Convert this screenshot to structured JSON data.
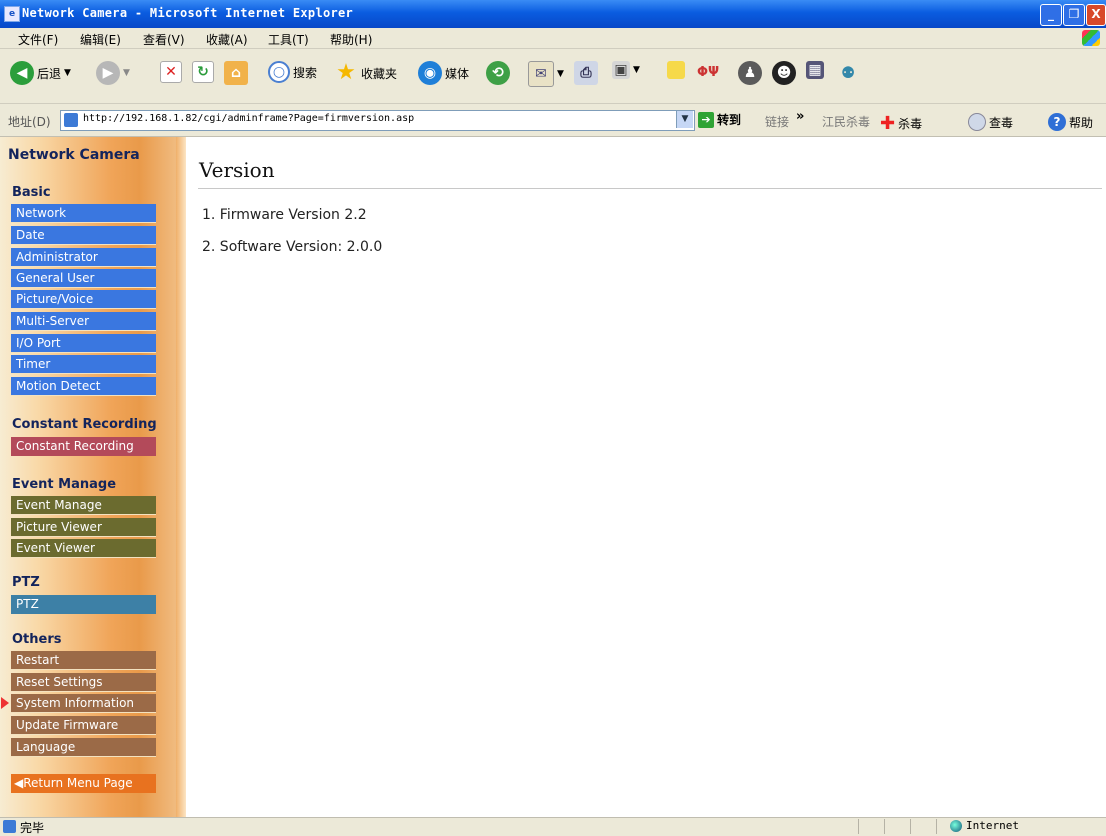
{
  "window": {
    "title": "Network Camera - Microsoft Internet Explorer",
    "min": "_",
    "max": "❐",
    "close": "X"
  },
  "menu": [
    "文件(F)",
    "编辑(E)",
    "查看(V)",
    "收藏(A)",
    "工具(T)",
    "帮助(H)"
  ],
  "toolbar": {
    "back": "后退",
    "search": "搜索",
    "favorites": "收藏夹",
    "media": "媒体"
  },
  "address": {
    "label": "地址(D)",
    "url": "http://192.168.1.82/cgi/adminframe?Page=firmversion.asp",
    "go": "转到",
    "links": "链接",
    "jiangmin": "江民杀毒",
    "kill": "杀毒",
    "scan": "查毒",
    "help": "帮助"
  },
  "sidebar": {
    "title": "Network Camera",
    "sections": {
      "basic": "Basic",
      "constant": "Constant Recording",
      "event": "Event Manage",
      "ptz": "PTZ",
      "others": "Others"
    },
    "basic_items": [
      "Network",
      "Date",
      "Administrator",
      "General User",
      "Picture/Voice",
      "Multi-Server",
      "I/O Port",
      "Timer",
      "Motion Detect"
    ],
    "constant_items": [
      "Constant Recording"
    ],
    "event_items": [
      "Event Manage",
      "Picture Viewer",
      "Event Viewer"
    ],
    "ptz_items": [
      "PTZ"
    ],
    "others_items": [
      "Restart",
      "Reset Settings",
      "System Information",
      "Update Firmware",
      "Language"
    ],
    "return": "Return Menu Page"
  },
  "content": {
    "title": "Version",
    "firmware": "1. Firmware Version  2.2",
    "software": "2. Software Version:  2.0.0"
  },
  "status": {
    "text": "完毕",
    "zone": "Internet"
  }
}
